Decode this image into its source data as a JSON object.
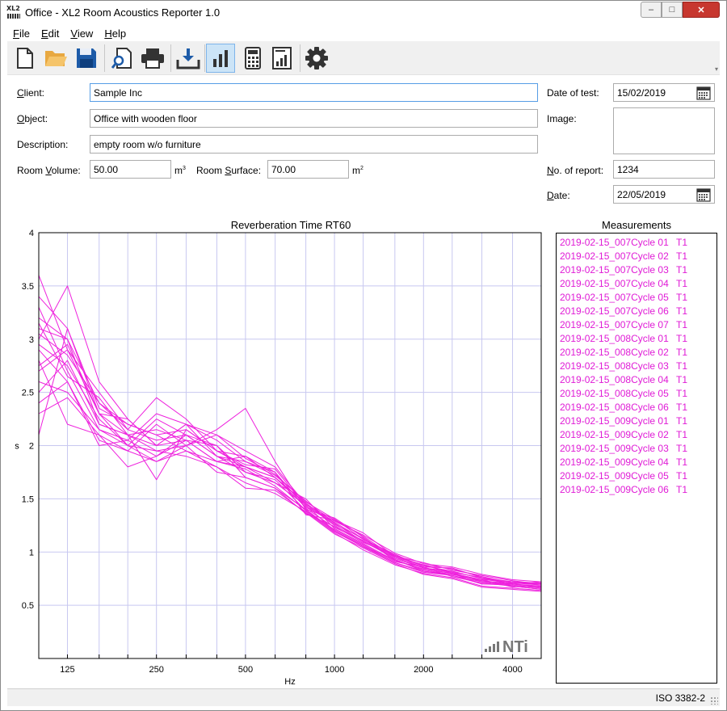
{
  "window": {
    "title": "Office - XL2 Room Acoustics Reporter 1.0",
    "icon_text": "XL2",
    "min_glyph": "–",
    "max_glyph": "□",
    "close_glyph": "✕"
  },
  "menu": [
    {
      "pre": "",
      "u": "F",
      "post": "ile"
    },
    {
      "pre": "",
      "u": "E",
      "post": "dit"
    },
    {
      "pre": "",
      "u": "V",
      "post": "iew"
    },
    {
      "pre": "",
      "u": "H",
      "post": "elp"
    }
  ],
  "toolbar": {
    "buttons": [
      "new-file-icon",
      "open-folder-icon",
      "save-icon",
      "print-preview-icon",
      "print-icon",
      "download-icon",
      "bar-chart-icon",
      "calculator-icon",
      "report-icon",
      "settings-gear-icon"
    ],
    "active": "bar-chart-icon",
    "overflow_glyph": "▾"
  },
  "form": {
    "client": {
      "label_u": "C",
      "label_rest": "lient:",
      "value": "Sample Inc"
    },
    "object": {
      "label_u": "O",
      "label_rest": "bject:",
      "value": "Office with wooden floor"
    },
    "description": {
      "label": "Description:",
      "value": "empty room w/o furniture"
    },
    "room_volume": {
      "label_pre": "Room ",
      "label_u": "V",
      "label_rest": "olume:",
      "value": "50.00",
      "unit": "m",
      "unit_sup": "3"
    },
    "room_surface": {
      "label_pre": "Room ",
      "label_u": "S",
      "label_rest": "urface:",
      "value": "70.00",
      "unit": "m",
      "unit_sup": "2"
    },
    "date_of_test": {
      "label": "Date of test:",
      "value": "15/02/2019"
    },
    "image": {
      "label": "Image:"
    },
    "report_no": {
      "label_u": "N",
      "label_rest": "o. of report:",
      "value": "1234"
    },
    "date": {
      "label_u": "D",
      "label_rest": "ate:",
      "value": "22/05/2019"
    }
  },
  "colors": {
    "series": "#ee22dd",
    "grid": "#c8c8f0",
    "focus": "#569de5",
    "close": "#c7372f"
  },
  "chart_data": {
    "type": "line",
    "title": "Reverberation Time RT60",
    "xlabel": "Hz",
    "ylabel": "s",
    "x_scale": "log",
    "xlim": [
      100,
      5000
    ],
    "ylim": [
      0,
      4
    ],
    "x_ticks": [
      125,
      250,
      500,
      1000,
      2000,
      4000
    ],
    "x_tick_labels": [
      "125",
      "250",
      "500",
      "1000",
      "2000",
      "4000"
    ],
    "y_ticks": [
      0.5,
      1,
      1.5,
      2,
      2.5,
      3,
      3.5,
      4
    ],
    "y_tick_labels": [
      "0.5",
      "1",
      "1.5",
      "2",
      "2.5",
      "3",
      "3.5",
      "4"
    ],
    "x": [
      100,
      125,
      160,
      200,
      250,
      315,
      400,
      500,
      630,
      800,
      1000,
      1250,
      1600,
      2000,
      2500,
      3150,
      4000,
      5000
    ],
    "series": [
      {
        "values": [
          3.6,
          2.9,
          2.3,
          2.1,
          2.0,
          2.2,
          1.9,
          1.8,
          1.7,
          1.45,
          1.25,
          1.1,
          0.95,
          0.85,
          0.82,
          0.75,
          0.7,
          0.68
        ]
      },
      {
        "values": [
          3.3,
          2.7,
          2.15,
          2.0,
          1.85,
          2.0,
          1.75,
          1.7,
          1.6,
          1.4,
          1.2,
          1.05,
          0.9,
          0.82,
          0.78,
          0.72,
          0.68,
          0.65
        ]
      },
      {
        "values": [
          3.1,
          3.0,
          2.4,
          2.2,
          2.1,
          2.15,
          1.95,
          1.9,
          1.75,
          1.35,
          1.3,
          1.15,
          0.95,
          0.88,
          0.8,
          0.74,
          0.72,
          0.7
        ]
      },
      {
        "values": [
          2.9,
          2.6,
          2.0,
          2.05,
          1.9,
          2.1,
          2.0,
          1.75,
          1.65,
          1.5,
          1.22,
          1.08,
          0.92,
          0.84,
          0.8,
          0.7,
          0.69,
          0.66
        ]
      },
      {
        "values": [
          2.5,
          2.8,
          2.2,
          2.1,
          2.15,
          2.05,
          1.85,
          1.8,
          1.7,
          1.42,
          1.28,
          1.12,
          0.98,
          0.86,
          0.85,
          0.76,
          0.7,
          0.72
        ]
      },
      {
        "values": [
          3.0,
          3.5,
          2.6,
          2.25,
          2.0,
          2.2,
          2.1,
          1.95,
          1.8,
          1.45,
          1.3,
          1.18,
          0.96,
          0.9,
          0.83,
          0.78,
          0.73,
          0.7
        ]
      },
      {
        "values": [
          2.1,
          3.1,
          2.3,
          2.0,
          1.95,
          1.9,
          1.8,
          1.65,
          1.55,
          1.38,
          1.18,
          1.02,
          0.88,
          0.8,
          0.76,
          0.68,
          0.66,
          0.64
        ]
      },
      {
        "values": [
          2.7,
          2.9,
          2.5,
          2.15,
          2.05,
          2.1,
          1.9,
          1.85,
          1.72,
          1.48,
          1.27,
          1.1,
          0.94,
          0.85,
          0.81,
          0.72,
          0.71,
          0.69
        ]
      },
      {
        "values": [
          2.4,
          2.6,
          2.05,
          1.95,
          2.2,
          2.0,
          2.15,
          2.35,
          1.85,
          1.4,
          1.32,
          1.14,
          0.93,
          0.83,
          0.79,
          0.74,
          0.67,
          0.68
        ]
      },
      {
        "values": [
          3.2,
          3.0,
          2.2,
          2.1,
          1.68,
          2.15,
          1.95,
          1.8,
          1.65,
          1.44,
          1.2,
          1.06,
          0.9,
          0.81,
          0.78,
          0.7,
          0.7,
          0.67
        ]
      },
      {
        "values": [
          2.8,
          2.2,
          2.1,
          1.8,
          1.9,
          2.05,
          2.0,
          1.7,
          1.6,
          1.36,
          1.24,
          1.09,
          0.97,
          0.87,
          0.82,
          0.75,
          0.72,
          0.71
        ]
      },
      {
        "values": [
          3.4,
          3.1,
          2.35,
          2.2,
          2.1,
          1.95,
          1.85,
          1.9,
          1.7,
          1.46,
          1.26,
          1.13,
          0.92,
          0.84,
          0.8,
          0.73,
          0.69,
          0.66
        ]
      },
      {
        "values": [
          2.95,
          2.75,
          2.25,
          2.0,
          2.25,
          2.1,
          1.9,
          1.75,
          1.68,
          1.39,
          1.21,
          1.07,
          0.91,
          0.86,
          0.77,
          0.71,
          0.68,
          0.65
        ]
      },
      {
        "values": [
          2.6,
          2.5,
          2.15,
          2.05,
          2.3,
          2.2,
          2.05,
          1.85,
          1.75,
          1.41,
          1.23,
          1.11,
          0.96,
          0.88,
          0.84,
          0.77,
          0.71,
          0.7
        ]
      },
      {
        "values": [
          3.05,
          2.85,
          2.4,
          2.15,
          2.45,
          2.25,
          1.95,
          1.82,
          1.78,
          1.43,
          1.29,
          1.16,
          0.99,
          0.89,
          0.86,
          0.79,
          0.74,
          0.72
        ]
      },
      {
        "values": [
          2.3,
          2.45,
          2.1,
          1.95,
          1.85,
          1.95,
          1.8,
          1.6,
          1.58,
          1.37,
          1.17,
          1.04,
          0.89,
          0.79,
          0.75,
          0.67,
          0.65,
          0.63
        ]
      },
      {
        "values": [
          2.75,
          2.95,
          2.3,
          2.25,
          2.0,
          2.05,
          1.85,
          1.78,
          1.62,
          1.39,
          1.19,
          1.05,
          0.93,
          0.82,
          0.79,
          0.73,
          0.7,
          0.67
        ]
      },
      {
        "values": [
          3.15,
          2.65,
          2.45,
          2.1,
          1.95,
          2.0,
          2.1,
          1.88,
          1.73,
          1.47,
          1.31,
          1.12,
          0.97,
          0.85,
          0.81,
          0.76,
          0.72,
          0.69
        ]
      }
    ],
    "logo_text": "NTi"
  },
  "measurements": {
    "title": "Measurements",
    "items": [
      {
        "name": "2019-02-15_007Cycle 01",
        "tag": "T1"
      },
      {
        "name": "2019-02-15_007Cycle 02",
        "tag": "T1"
      },
      {
        "name": "2019-02-15_007Cycle 03",
        "tag": "T1"
      },
      {
        "name": "2019-02-15_007Cycle 04",
        "tag": "T1"
      },
      {
        "name": "2019-02-15_007Cycle 05",
        "tag": "T1"
      },
      {
        "name": "2019-02-15_007Cycle 06",
        "tag": "T1"
      },
      {
        "name": "2019-02-15_007Cycle 07",
        "tag": "T1"
      },
      {
        "name": "2019-02-15_008Cycle 01",
        "tag": "T1"
      },
      {
        "name": "2019-02-15_008Cycle 02",
        "tag": "T1"
      },
      {
        "name": "2019-02-15_008Cycle 03",
        "tag": "T1"
      },
      {
        "name": "2019-02-15_008Cycle 04",
        "tag": "T1"
      },
      {
        "name": "2019-02-15_008Cycle 05",
        "tag": "T1"
      },
      {
        "name": "2019-02-15_008Cycle 06",
        "tag": "T1"
      },
      {
        "name": "2019-02-15_009Cycle 01",
        "tag": "T1"
      },
      {
        "name": "2019-02-15_009Cycle 02",
        "tag": "T1"
      },
      {
        "name": "2019-02-15_009Cycle 03",
        "tag": "T1"
      },
      {
        "name": "2019-02-15_009Cycle 04",
        "tag": "T1"
      },
      {
        "name": "2019-02-15_009Cycle 05",
        "tag": "T1"
      },
      {
        "name": "2019-02-15_009Cycle 06",
        "tag": "T1"
      }
    ]
  },
  "status": {
    "standard": "ISO 3382-2"
  }
}
